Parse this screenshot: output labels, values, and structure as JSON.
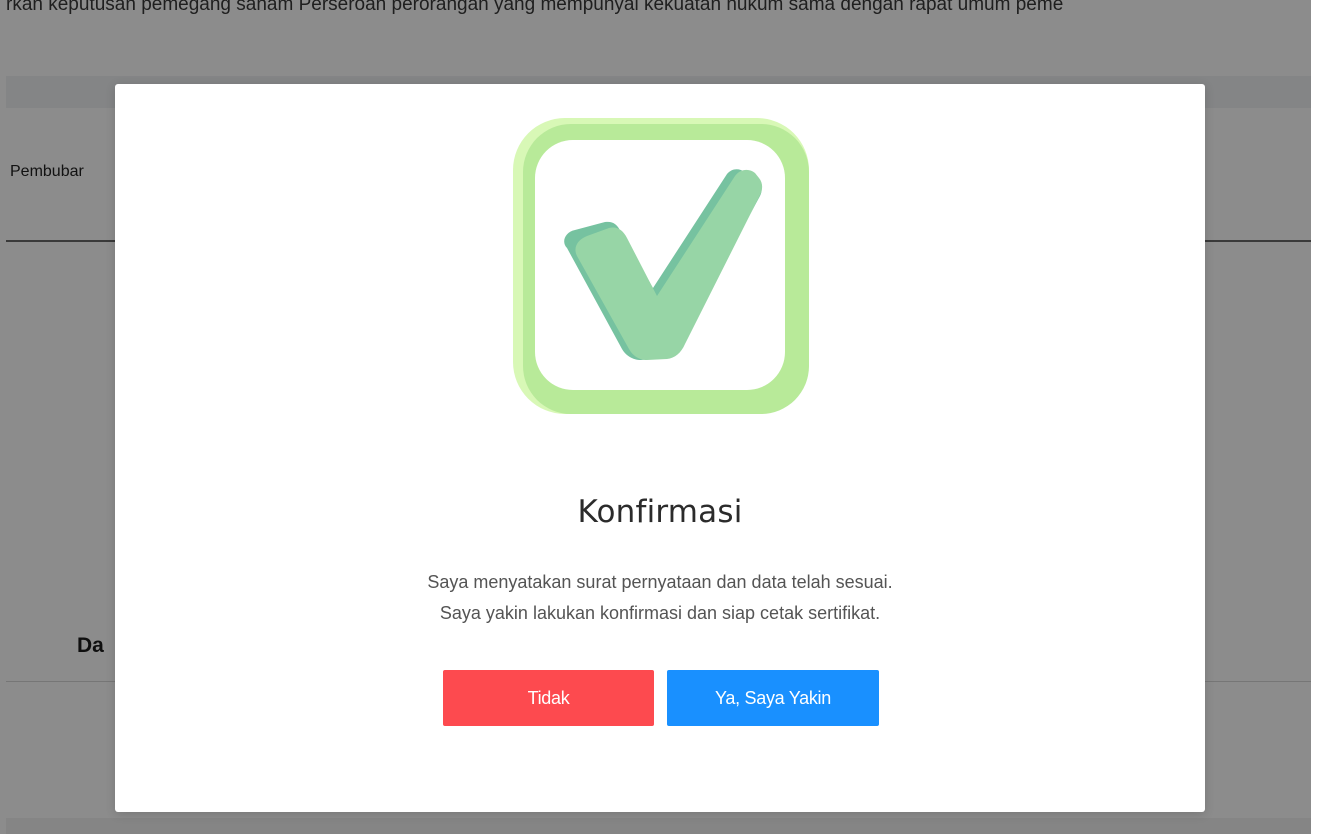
{
  "background": {
    "top_text": "rkan keputusan pemegang saham Perseroan perorangan yang mempunyai kekuatan hukum sama dengan rapat umum peme",
    "tab_label": "Pembubar",
    "section_title": "Da"
  },
  "modal": {
    "icon": "checkmark-square-icon",
    "title": "Konfirmasi",
    "message_line_1": "Saya menyatakan surat pernyataan dan data telah sesuai.",
    "message_line_2": "Saya yakin lakukan konfirmasi dan siap cetak sertifikat.",
    "cancel_label": "Tidak",
    "confirm_label": "Ya, Saya Yakin"
  },
  "colors": {
    "overlay": "#000000",
    "cancel_button": "#fd4a4f",
    "confirm_button": "#1990ff",
    "check_fill": "#97d5a6",
    "check_shadow": "#76c2a0",
    "frame_light": "#d8f8b6",
    "frame_mid": "#b8ea99"
  }
}
